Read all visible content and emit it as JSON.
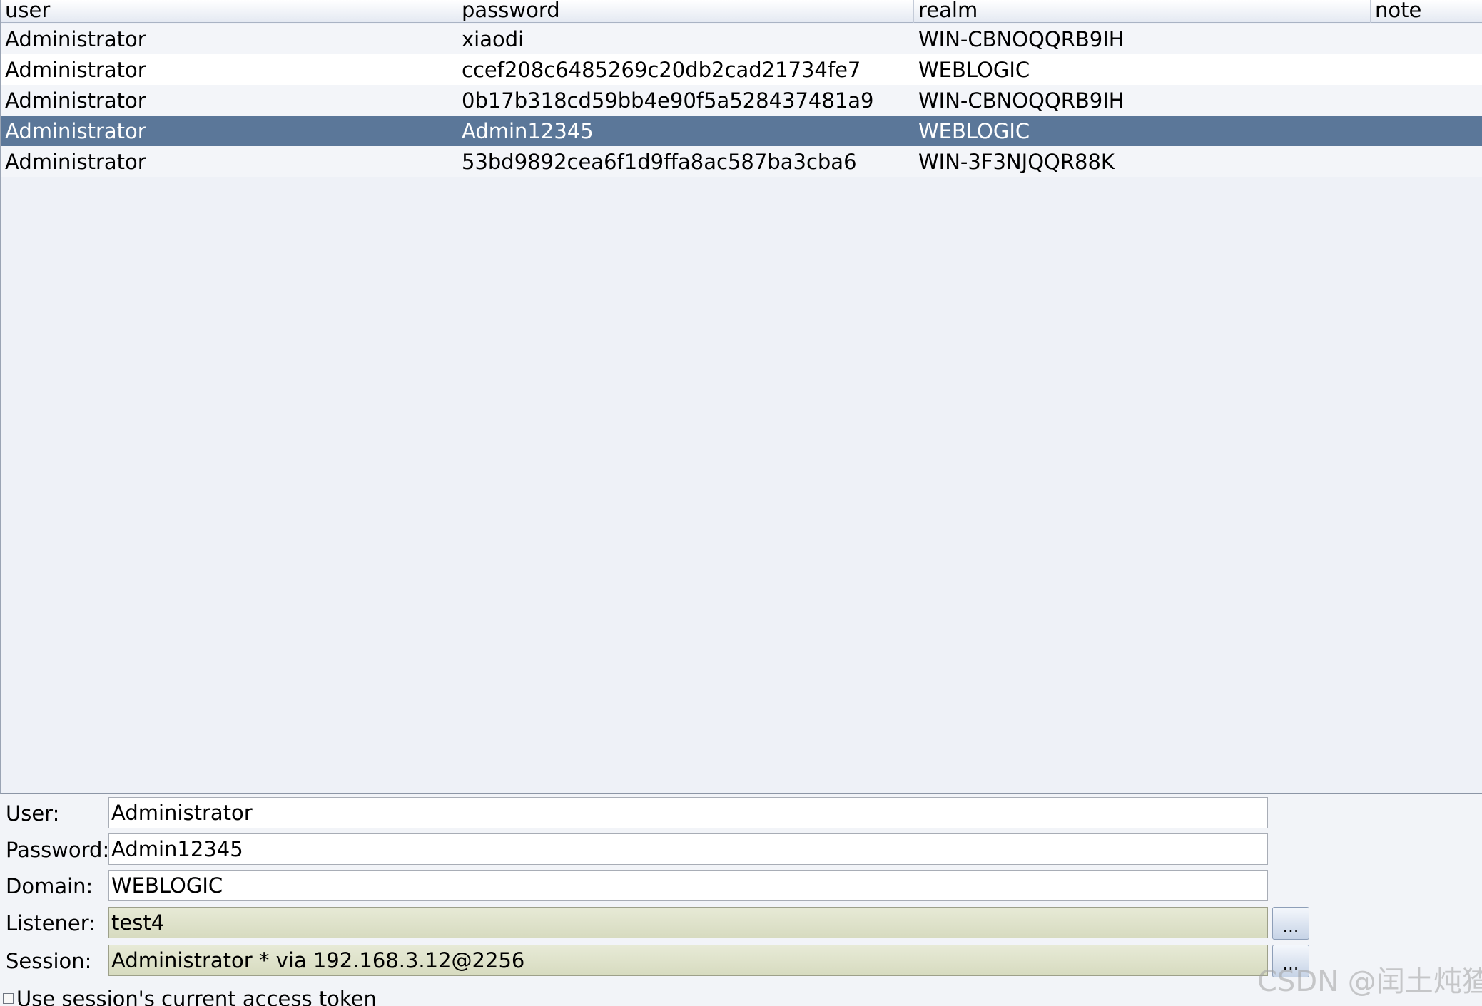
{
  "table": {
    "columns": [
      "user",
      "password",
      "realm",
      "note"
    ],
    "rows": [
      {
        "user": "Administrator",
        "password": "xiaodi",
        "realm": "WIN-CBNOQQRB9IH",
        "note": ""
      },
      {
        "user": "Administrator",
        "password": "ccef208c6485269c20db2cad21734fe7",
        "realm": "WEBLOGIC",
        "note": ""
      },
      {
        "user": "Administrator",
        "password": "0b17b318cd59bb4e90f5a528437481a9",
        "realm": "WIN-CBNOQQRB9IH",
        "note": ""
      },
      {
        "user": "Administrator",
        "password": "Admin12345",
        "realm": "WEBLOGIC",
        "note": ""
      },
      {
        "user": "Administrator",
        "password": "53bd9892cea6f1d9ffa8ac587ba3cba6",
        "realm": "WIN-3F3NJQQR88K",
        "note": ""
      }
    ],
    "selected_row_index": 3
  },
  "form": {
    "user_label": "User:",
    "user_value": "Administrator",
    "password_label": "Password:",
    "password_value": "Admin12345",
    "domain_label": "Domain:",
    "domain_value": "WEBLOGIC",
    "listener_label": "Listener:",
    "listener_value": "test4",
    "listener_button": "...",
    "session_label": "Session:",
    "session_value": "Administrator * via  192.168.3.12@2256",
    "session_button": "...",
    "token_checkbox_label": "Use session's current access token"
  },
  "watermark": "CSDN @闰土炖猹"
}
